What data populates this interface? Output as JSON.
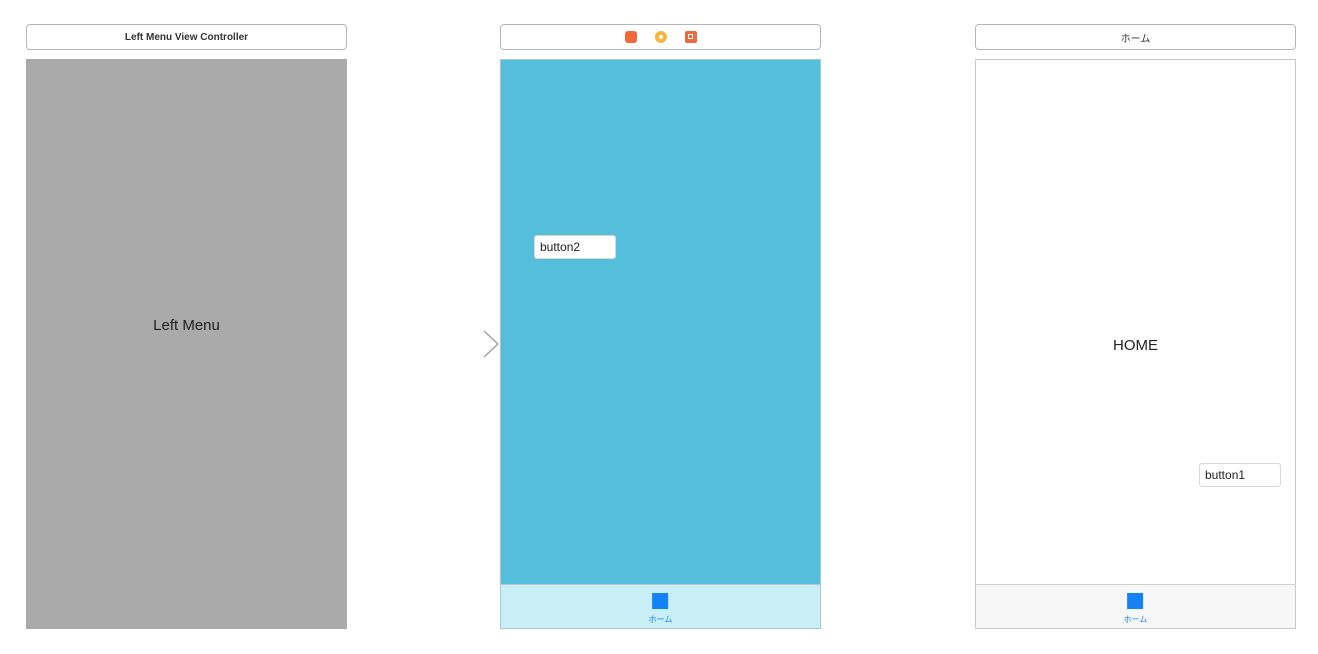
{
  "scenes": {
    "left": {
      "header_title": "Left Menu View Controller",
      "content_label": "Left Menu",
      "background_color": "#aaaaaa"
    },
    "middle": {
      "header_icons": [
        "view-controller-icon",
        "first-responder-icon",
        "exit-icon"
      ],
      "button_label": "button2",
      "background_color": "#54bedb",
      "tab_bar": {
        "item_label": "ホーム",
        "item_icon": "tab-square-icon",
        "background_color": "#c9eff6"
      }
    },
    "right": {
      "header_title": "ホーム",
      "content_label": "HOME",
      "button_label": "button1",
      "background_color": "#ffffff",
      "tab_bar": {
        "item_label": "ホーム",
        "item_icon": "tab-square-icon",
        "background_color": "#f7f7f7"
      }
    }
  },
  "segue": {
    "icon": "entry-point-arrow-icon"
  },
  "accent_color": "#1581f7"
}
